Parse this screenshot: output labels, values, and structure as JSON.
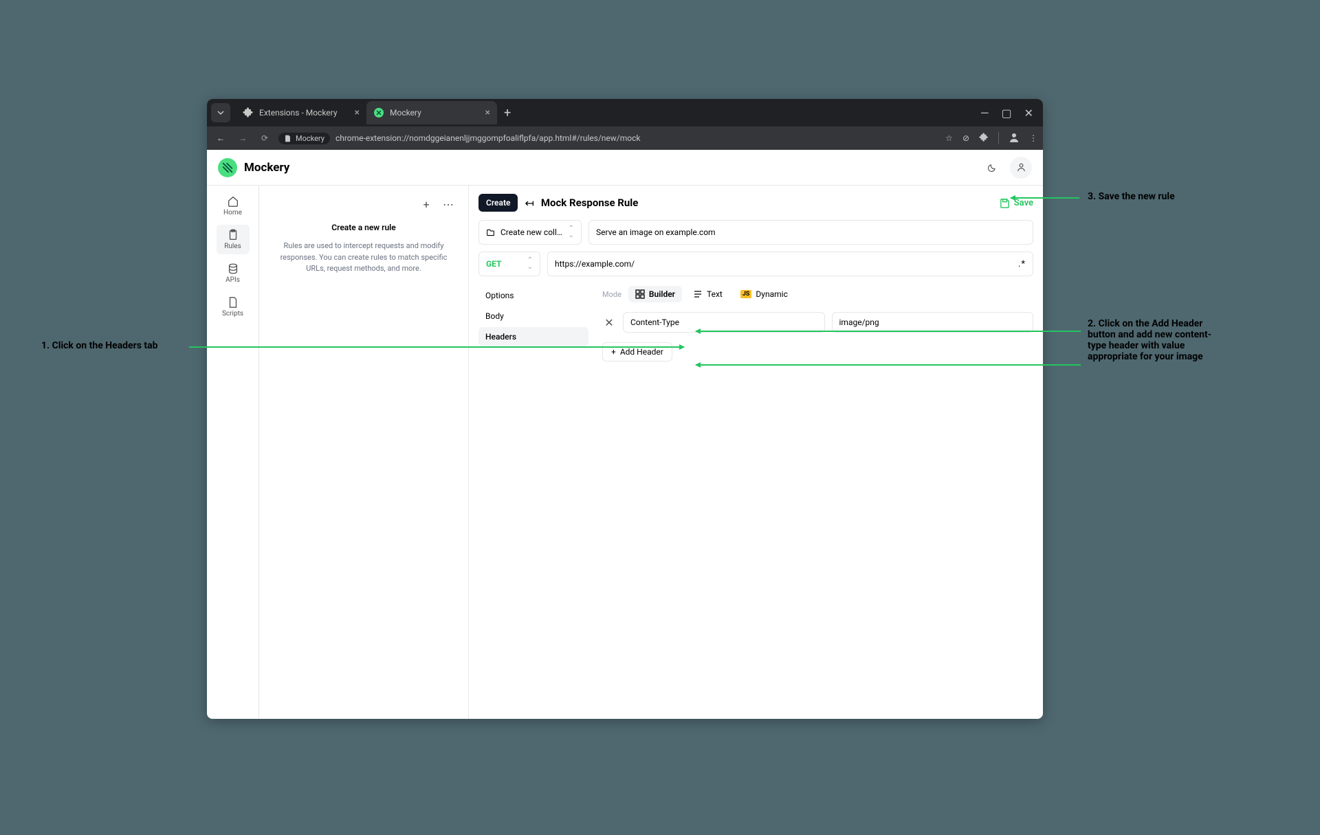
{
  "browser": {
    "tabs": [
      {
        "title": "Extensions - Mockery"
      },
      {
        "title": "Mockery"
      }
    ],
    "url_chip": "Mockery",
    "url": "chrome-extension://nomdggeianenljjmggompfoaliflpfa/app.html#/rules/new/mock"
  },
  "header": {
    "brand": "Mockery"
  },
  "nav": {
    "items": [
      "Home",
      "Rules",
      "APIs",
      "Scripts"
    ]
  },
  "panel": {
    "title": "Create a new rule",
    "desc": "Rules are used to intercept requests and modify responses. You can create rules to match specific URLs, request methods, and more."
  },
  "main": {
    "create": "Create",
    "title": "Mock Response Rule",
    "save": "Save",
    "collection": "Create new coll…",
    "rule_name": "Serve an image on example.com",
    "method": "GET",
    "url": "https://example.com/",
    "wildcard": ".*",
    "subtabs": [
      "Options",
      "Body",
      "Headers"
    ],
    "mode_label": "Mode",
    "modes": [
      "Builder",
      "Text",
      "Dynamic"
    ],
    "header_key": "Content-Type",
    "header_value": "image/png",
    "add_header": "Add Header"
  },
  "annotations": {
    "a1": "1. Click on the Headers tab",
    "a2": "2. Click on the Add Header button and add new content-type header with value appropriate for your image",
    "a3": "3. Save the new rule"
  }
}
